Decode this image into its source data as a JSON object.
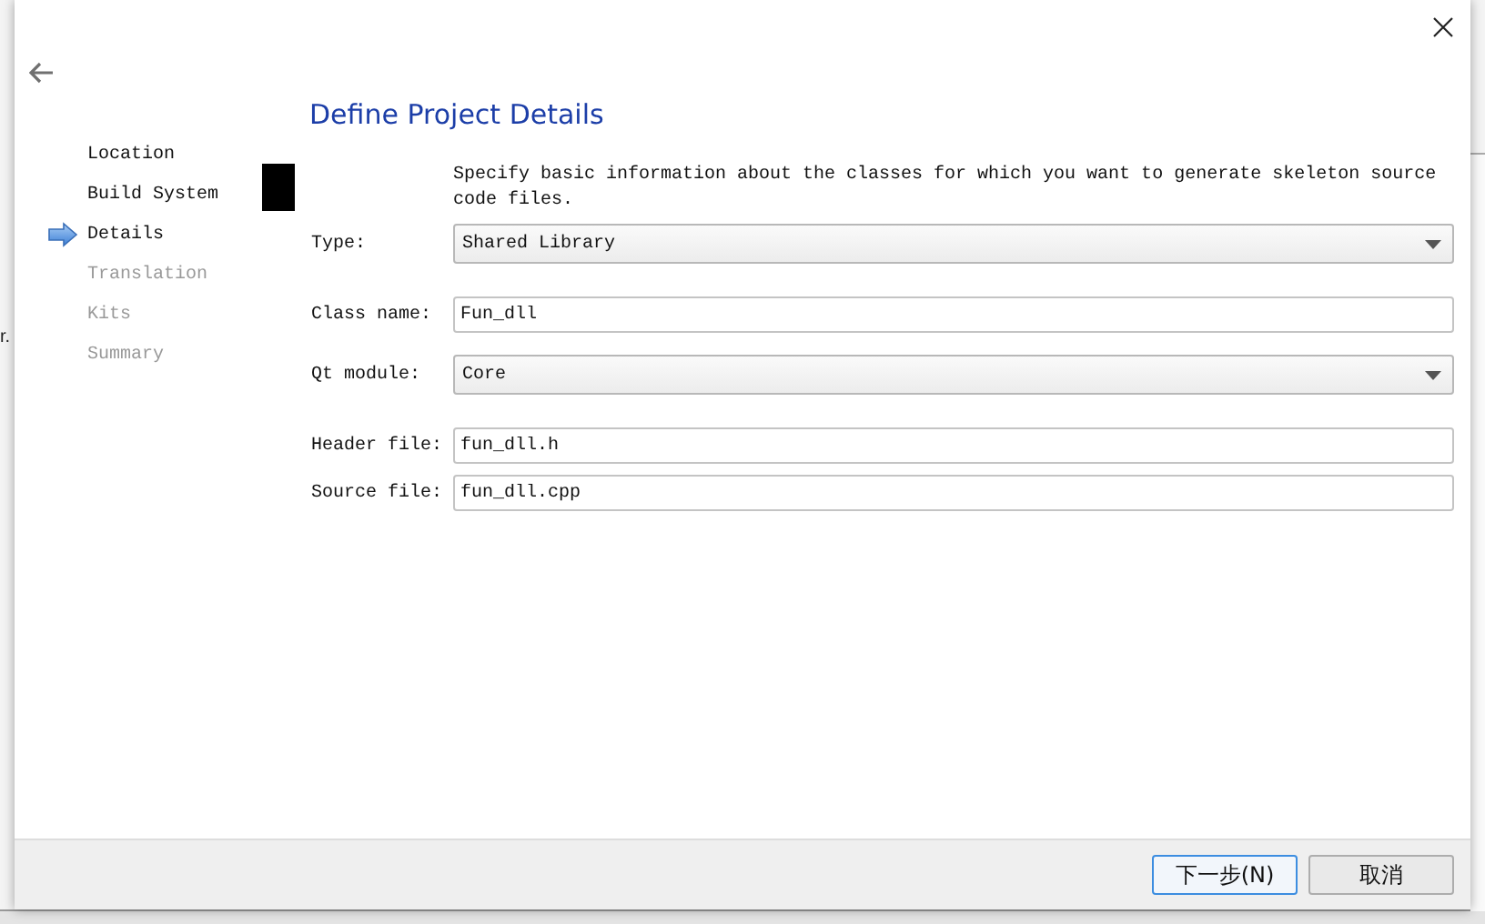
{
  "background_text": "r.",
  "steps": [
    {
      "label": "Location",
      "selected": false,
      "disabled": false
    },
    {
      "label": "Build System",
      "selected": false,
      "disabled": false
    },
    {
      "label": "Details",
      "selected": true,
      "disabled": false
    },
    {
      "label": "Translation",
      "selected": false,
      "disabled": true
    },
    {
      "label": "Kits",
      "selected": false,
      "disabled": true
    },
    {
      "label": "Summary",
      "selected": false,
      "disabled": true
    }
  ],
  "page": {
    "title": "Define Project Details",
    "description": "Specify basic information about the classes for which you want to generate skeleton source code files."
  },
  "fields": [
    {
      "kind": "combo",
      "label": "Type:",
      "value": "Shared Library"
    },
    {
      "kind": "text",
      "label": "Class name:",
      "value": "Fun_dll"
    },
    {
      "kind": "combo",
      "label": "Qt module:",
      "value": "Core"
    },
    {
      "kind": "text",
      "label": "Header file:",
      "value": "fun_dll.h"
    },
    {
      "kind": "text",
      "label": "Source file:",
      "value": "fun_dll.cpp"
    }
  ],
  "buttons": [
    {
      "label": "下一步(N)",
      "default": true
    },
    {
      "label": "取消",
      "default": false
    }
  ]
}
